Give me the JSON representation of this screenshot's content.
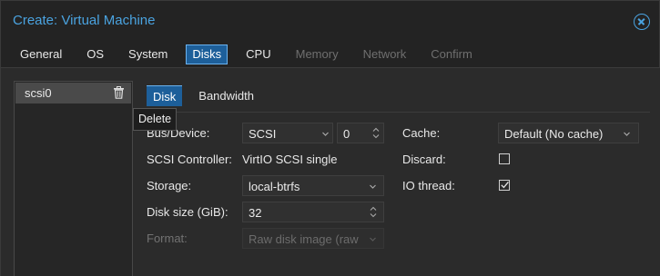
{
  "window": {
    "title": "Create: Virtual Machine"
  },
  "tabs": [
    "General",
    "OS",
    "System",
    "Disks",
    "CPU",
    "Memory",
    "Network",
    "Confirm"
  ],
  "disk_list": {
    "items": [
      {
        "label": "scsi0"
      }
    ],
    "tooltip": "Delete"
  },
  "subtabs": [
    "Disk",
    "Bandwidth"
  ],
  "form": {
    "bus_device": {
      "label": "Bus/Device:",
      "bus": "SCSI",
      "device": "0"
    },
    "scsi_controller": {
      "label": "SCSI Controller:",
      "value": "VirtIO SCSI single"
    },
    "storage": {
      "label": "Storage:",
      "value": "local-btrfs"
    },
    "disk_size": {
      "label": "Disk size (GiB):",
      "value": "32"
    },
    "format": {
      "label": "Format:",
      "value": "Raw disk image (raw"
    },
    "cache": {
      "label": "Cache:",
      "value": "Default (No cache)"
    },
    "discard": {
      "label": "Discard:",
      "checked": false
    },
    "io_thread": {
      "label": "IO thread:",
      "checked": true
    }
  },
  "colors": {
    "accent": "#4aa3e0",
    "active_tab": "#1d5f9a"
  }
}
